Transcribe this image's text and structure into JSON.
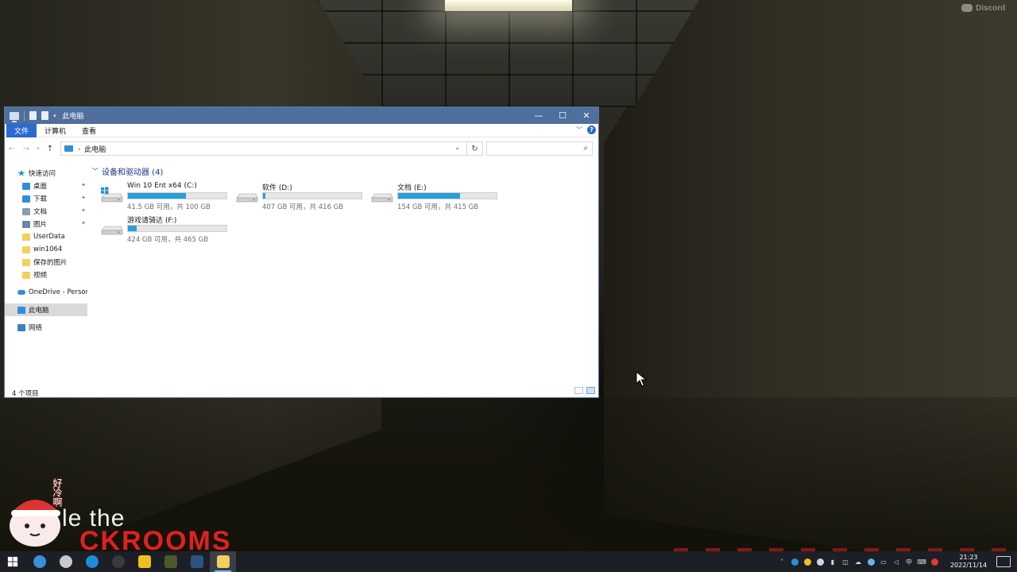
{
  "watermark": {
    "label": "Discord"
  },
  "overlay": {
    "line1": "le the",
    "line2": "CKROOMS",
    "mascot_text": "好冷啊"
  },
  "window": {
    "title": "此电脑",
    "controls": {
      "minimize": "—",
      "maximize": "☐",
      "close": "✕"
    },
    "ribbon_tabs": [
      "文件",
      "计算机",
      "查看"
    ],
    "address": {
      "path": "此电脑",
      "separator": "›"
    },
    "search": {
      "placeholder": ""
    },
    "nav_pane": {
      "quick_access": "快速访问",
      "quick_items": [
        {
          "label": "桌面",
          "pinned": true,
          "color": "#2e8fd6"
        },
        {
          "label": "下载",
          "pinned": true,
          "color": "#2e8fd6"
        },
        {
          "label": "文档",
          "pinned": true,
          "color": "#8a9bb0"
        },
        {
          "label": "图片",
          "pinned": true,
          "color": "#6a86a8"
        },
        {
          "label": "UserData",
          "pinned": false,
          "color": "#f3cf5b"
        },
        {
          "label": "win1064",
          "pinned": false,
          "color": "#f3cf5b"
        },
        {
          "label": "保存的图片",
          "pinned": false,
          "color": "#f3cf5b"
        },
        {
          "label": "视频",
          "pinned": false,
          "color": "#f3cf5b"
        }
      ],
      "onedrive": "OneDrive - Persona",
      "this_pc": "此电脑",
      "network": "网络"
    },
    "group_title": "设备和驱动器 (4)",
    "drives": [
      {
        "name": "Win 10 Ent x64 (C:)",
        "free_text": "41.5 GB 可用，共 100 GB",
        "used_fraction": 0.585,
        "icon": "windows-drive-icon"
      },
      {
        "name": "软件 (D:)",
        "free_text": "407 GB 可用，共 416 GB",
        "used_fraction": 0.022,
        "icon": "drive-icon"
      },
      {
        "name": "文档 (E:)",
        "free_text": "154 GB 可用，共 415 GB",
        "used_fraction": 0.629,
        "icon": "drive-icon"
      },
      {
        "name": "游戏请骑达 (F:)",
        "free_text": "424 GB 可用，共 465 GB",
        "used_fraction": 0.088,
        "icon": "drive-icon"
      }
    ],
    "status": "4 个项目"
  },
  "taskbar": {
    "apps": [
      {
        "name": "start",
        "color": "#ffffff"
      },
      {
        "name": "chrome",
        "color": "#3a8fd9"
      },
      {
        "name": "chat",
        "color": "#c9c9c9"
      },
      {
        "name": "edge",
        "color": "#1b8dd9"
      },
      {
        "name": "obs",
        "color": "#3a3a3a"
      },
      {
        "name": "app-owl",
        "color": "#f0c020"
      },
      {
        "name": "app-game",
        "color": "#4a5a2a"
      },
      {
        "name": "steam",
        "color": "#2a5580"
      },
      {
        "name": "explorer",
        "color": "#f3cf5b"
      }
    ],
    "tray_lang": "中",
    "clock_time": "21:23",
    "clock_date": "2022/11/14"
  }
}
